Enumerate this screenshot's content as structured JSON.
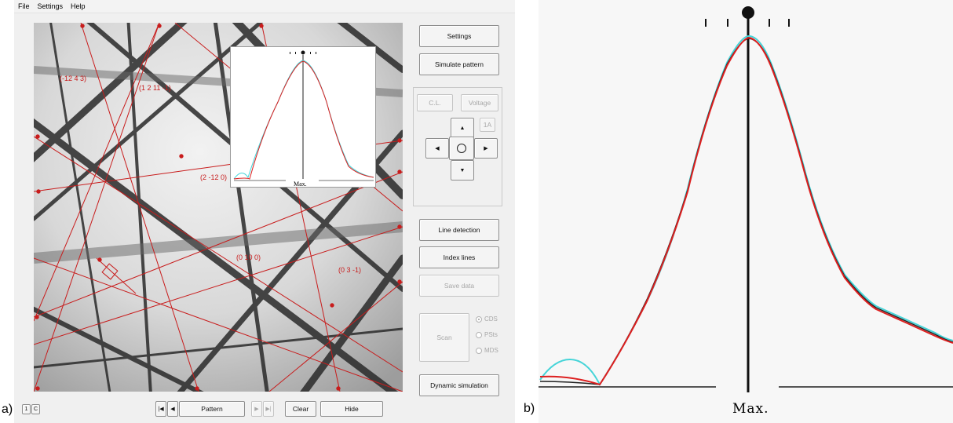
{
  "labels": {
    "a": "a)",
    "b": "b)"
  },
  "menu": [
    "File",
    "Settings",
    "Help"
  ],
  "bands": [
    {
      "label": "(-12 4 3)"
    },
    {
      "label": "(1 2 11 -1)"
    },
    {
      "label": "(2 -12 0)"
    },
    {
      "label": "(0 10 0)"
    },
    {
      "label": "(0 3 -1)"
    }
  ],
  "buttons": {
    "settings": "Settings",
    "simulate": "Simulate pattern",
    "cl": "C.L.",
    "voltage": "Voltage",
    "step": "1A",
    "line_detection": "Line detection",
    "index_lines": "Index lines",
    "save_data": "Save data",
    "scan": "Scan",
    "dynamic_simulation": "Dynamic simulation",
    "pattern": "Pattern",
    "clear": "Clear",
    "hide": "Hide",
    "small_left": "1",
    "small_right": "C"
  },
  "radios": [
    {
      "label": "CDS",
      "checked": true
    },
    {
      "label": "PSts",
      "checked": false
    },
    {
      "label": "MDS",
      "checked": false
    }
  ],
  "profile": {
    "marker_label": "Max.",
    "colors": {
      "measured": "#44d4d8",
      "simulated": "#dd1f1f",
      "third": "#222222"
    }
  },
  "icons": [
    "first-icon",
    "prev-icon",
    "next-icon",
    "last-icon",
    "arrow-up-icon",
    "arrow-down-icon",
    "arrow-left-icon",
    "arrow-right-icon",
    "center-circle-icon"
  ]
}
